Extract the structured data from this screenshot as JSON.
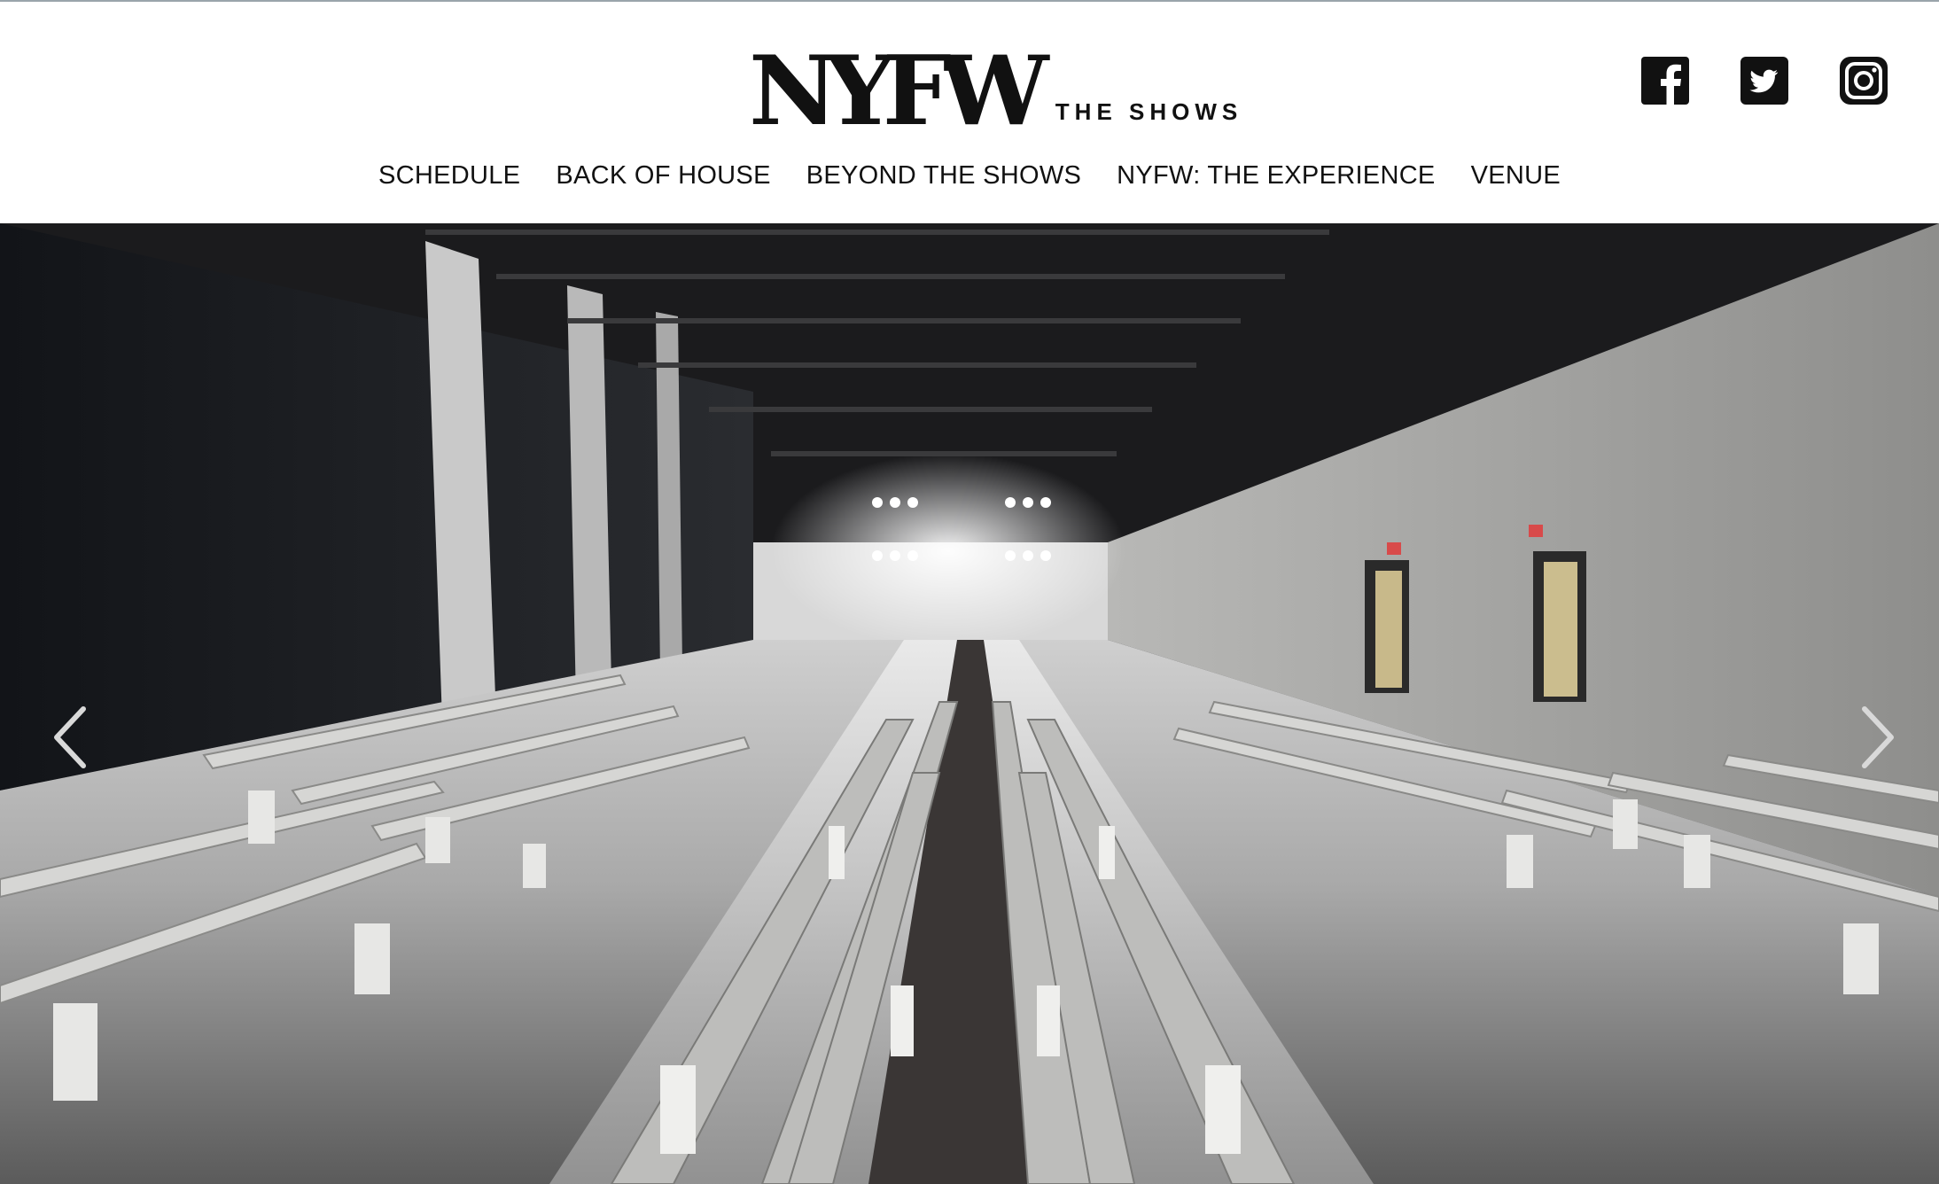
{
  "header": {
    "logo": {
      "mark": "NYFW",
      "subtitle": "THE SHOWS"
    },
    "social": [
      {
        "name": "facebook",
        "icon": "facebook-icon"
      },
      {
        "name": "twitter",
        "icon": "twitter-icon"
      },
      {
        "name": "instagram",
        "icon": "instagram-icon"
      }
    ]
  },
  "nav": {
    "items": [
      {
        "label": "SCHEDULE"
      },
      {
        "label": "BACK OF HOUSE"
      },
      {
        "label": "BEYOND THE SHOWS"
      },
      {
        "label": "NYFW: THE EXPERIENCE"
      },
      {
        "label": "VENUE"
      }
    ]
  },
  "hero": {
    "image": "runway-venue-photo",
    "prev_icon": "chevron-left-icon",
    "next_icon": "chevron-right-icon"
  },
  "colors": {
    "text": "#111111",
    "background": "#ffffff",
    "arrow": "#d9d9d9"
  }
}
